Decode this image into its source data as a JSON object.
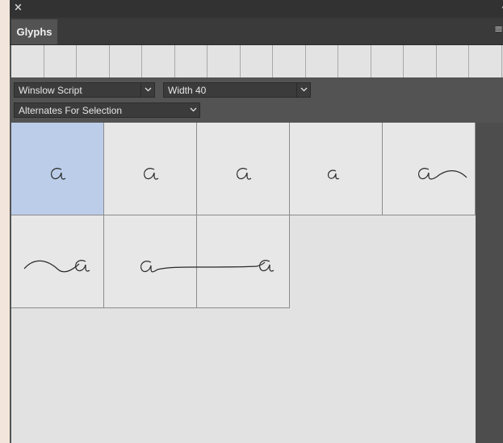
{
  "panel": {
    "close_icon": "close-icon",
    "collapse_icon": "collapse-arrows-icon",
    "tab_label": "Glyphs",
    "menu_icon": "panel-menu-icon"
  },
  "recent_glyphs": {
    "count": 15,
    "values": []
  },
  "controls": {
    "font_family": "Winslow Script",
    "font_style": "Width 40",
    "show": "Alternates For Selection"
  },
  "glyphs": [
    {
      "char": "a",
      "variant": "plain",
      "selected": true
    },
    {
      "char": "a",
      "variant": "plain-alt"
    },
    {
      "char": "a",
      "variant": "plain-alt2"
    },
    {
      "char": "a",
      "variant": "plain-small"
    },
    {
      "char": "a",
      "variant": "swash-right"
    },
    {
      "char": "a",
      "variant": "swash-left"
    },
    {
      "char": "a",
      "variant": "tail-right"
    },
    {
      "char": "a",
      "variant": "tail-left"
    }
  ],
  "colors": {
    "panel_bg": "#535353",
    "glyph_bg": "#e7e7e7",
    "selected_bg": "#bccde9"
  }
}
